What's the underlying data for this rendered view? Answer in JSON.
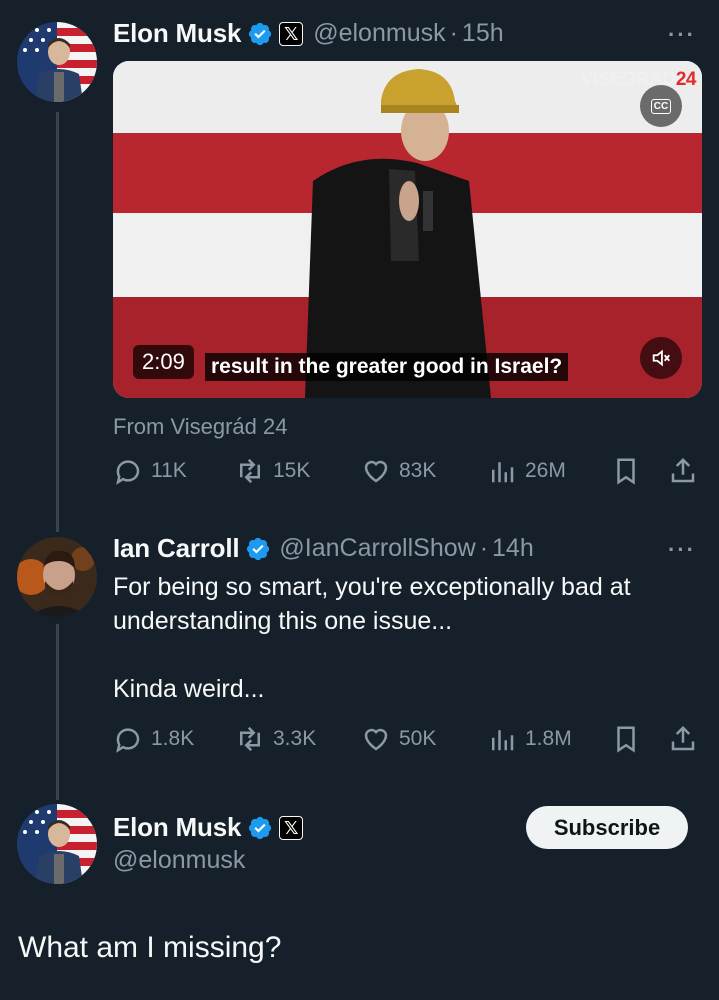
{
  "colors": {
    "background": "#15202b",
    "text_primary": "#f7f9f9",
    "text_secondary": "#8b98a5",
    "verified_blue": "#1d9bf0",
    "thread_line": "#38444d"
  },
  "original_tweet": {
    "name": "Elon Musk",
    "handle": "@elonmusk",
    "time": "15h",
    "separator": "·",
    "more": "···",
    "avatar_icon": "avatar-american-flag-portrait",
    "media": {
      "watermark_main": "VISEGRAD",
      "watermark_accent": "24",
      "cc_label": "CC",
      "duration": "2:09",
      "caption": "result in the greater good in Israel?",
      "mute_icon": "mute-icon"
    },
    "source": "From Visegrád 24",
    "stats": {
      "replies": "11K",
      "reposts": "15K",
      "likes": "83K",
      "views": "26M"
    }
  },
  "quoted_reply": {
    "name": "Ian Carroll",
    "handle": "@IanCarrollShow",
    "time": "14h",
    "separator": "·",
    "more": "···",
    "text_line1": "For being so smart, you're exceptionally bad at",
    "text_line2": "understanding this one issue...",
    "text_line3": "Kinda weird...",
    "stats": {
      "replies": "1.8K",
      "reposts": "3.3K",
      "likes": "50K",
      "views": "1.8M"
    }
  },
  "main_reply": {
    "name": "Elon Musk",
    "handle": "@elonmusk",
    "subscribe_label": "Subscribe",
    "text": "What am I missing?"
  }
}
